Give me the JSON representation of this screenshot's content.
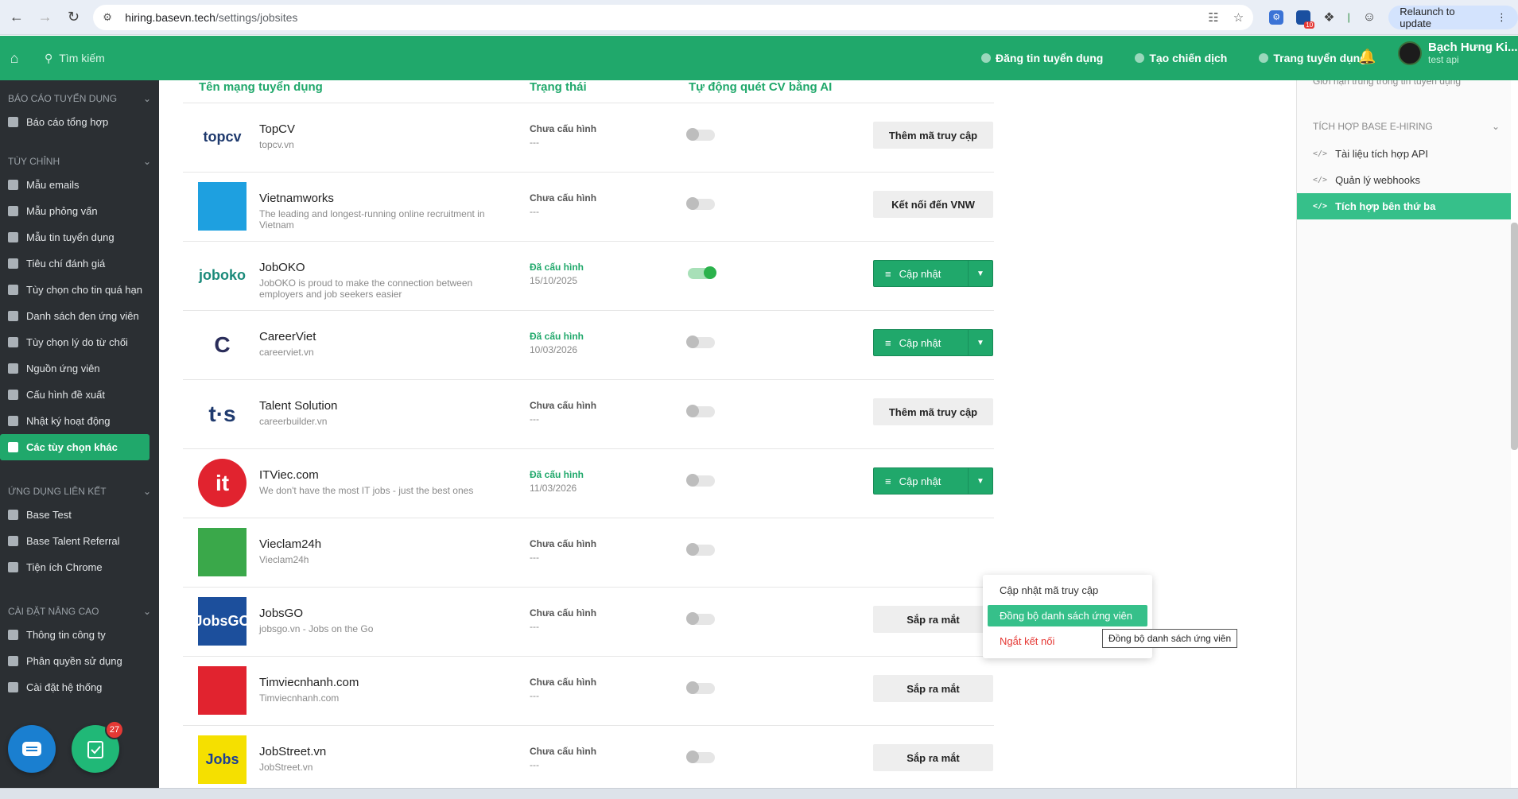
{
  "browser": {
    "url_host": "hiring.basevn.tech",
    "url_path": "/settings/jobsites",
    "relaunch_label": "Relaunch to update",
    "ext_badge": "10"
  },
  "header": {
    "search_placeholder": "Tìm kiếm",
    "actions": [
      "Đăng tin tuyển dụng",
      "Tạo chiến dịch",
      "Trang tuyển dụng"
    ],
    "user_name": "Bạch Hưng Ki...",
    "user_role": "test api"
  },
  "sidebar": {
    "sections": [
      {
        "title": "BÁO CÁO TUYỂN DỤNG",
        "items": [
          "Báo cáo tổng hợp"
        ]
      },
      {
        "title": "TÙY CHỈNH",
        "items": [
          "Mẫu emails",
          "Mẫu phỏng vấn",
          "Mẫu tin tuyển dụng",
          "Tiêu chí đánh giá",
          "Tùy chọn cho tin quá hạn",
          "Danh sách đen ứng viên",
          "Tùy chọn lý do từ chối",
          "Nguồn ứng viên",
          "Cấu hình đề xuất",
          "Nhật ký hoạt động",
          "Các tùy chọn khác"
        ]
      },
      {
        "title": "ỨNG DỤNG LIÊN KẾT",
        "items": [
          "Base Test",
          "Base Talent Referral",
          "Tiện ích Chrome"
        ]
      },
      {
        "title": "CÀI ĐẶT NÂNG CAO",
        "items": [
          "Thông tin công ty",
          "Phân quyền sử dụng",
          "Cài đặt hệ thống"
        ]
      }
    ],
    "active_item": "Các tùy chọn khác",
    "badge_count": "27"
  },
  "table": {
    "columns": [
      "Tên mạng tuyển dụng",
      "Trạng thái",
      "Tự động quét CV bằng AI"
    ],
    "rows": [
      {
        "name": "TopCV",
        "sub": "topcv.vn",
        "status": "Chưa cấu hình",
        "date": "---",
        "ai": false,
        "button": "Thêm mã truy cập",
        "btype": "grey",
        "logo_text": "topcv",
        "logo_color": "#1f3a6e"
      },
      {
        "name": "Vietnamworks",
        "sub": "The leading and longest-running online recruitment in Vietnam",
        "status": "Chưa cấu hình",
        "date": "---",
        "ai": false,
        "button": "Kết nối đến VNW",
        "btype": "grey",
        "logo_text": "",
        "logo_color": "#1ea0e0"
      },
      {
        "name": "JobOKO",
        "sub": "JobOKO is proud to make the connection between employers and job seekers easier",
        "status": "Đã cấu hình",
        "date": "15/10/2025",
        "ai": true,
        "button": "Cập nhật",
        "btype": "green",
        "logo_text": "joboko",
        "logo_color": "#1a8a7a"
      },
      {
        "name": "CareerViet",
        "sub": "careerviet.vn",
        "status": "Đã cấu hình",
        "date": "10/03/2026",
        "ai": false,
        "button": "Cập nhật",
        "btype": "green",
        "logo_text": "C",
        "logo_color": "#2a2d5a"
      },
      {
        "name": "Talent Solution",
        "sub": "careerbuilder.vn",
        "status": "Chưa cấu hình",
        "date": "---",
        "ai": false,
        "button": "Thêm mã truy cập",
        "btype": "grey",
        "logo_text": "t·s",
        "logo_color": "#1f3a6e"
      },
      {
        "name": "ITViec.com",
        "sub": "We don't have the most IT jobs - just the best ones",
        "status": "Đã cấu hình",
        "date": "11/03/2026",
        "ai": false,
        "button": "Cập nhật",
        "btype": "green",
        "logo_text": "it",
        "logo_color": "#e1232f"
      },
      {
        "name": "Vieclam24h",
        "sub": "Vieclam24h",
        "status": "Chưa cấu hình",
        "date": "---",
        "ai": false,
        "button": "",
        "btype": "none",
        "logo_text": "",
        "logo_color": "#3aa84a"
      },
      {
        "name": "JobsGO",
        "sub": "jobsgo.vn - Jobs on the Go",
        "status": "Chưa cấu hình",
        "date": "---",
        "ai": false,
        "button": "Sắp ra mắt",
        "btype": "grey",
        "logo_text": "JobsGO",
        "logo_color": "#1c4f9c"
      },
      {
        "name": "Timviecnhanh.com",
        "sub": "Timviecnhanh.com",
        "status": "Chưa cấu hình",
        "date": "---",
        "ai": false,
        "button": "Sắp ra mắt",
        "btype": "grey",
        "logo_text": "",
        "logo_color": "#e1232f"
      },
      {
        "name": "JobStreet.vn",
        "sub": "JobStreet.vn",
        "status": "Chưa cấu hình",
        "date": "---",
        "ai": false,
        "button": "Sắp ra mắt",
        "btype": "grey",
        "logo_text": "Jobs",
        "logo_color": "#f5e000"
      }
    ]
  },
  "dropdown": {
    "items": [
      "Cập nhật mã truy cập",
      "Đồng bộ danh sách ứng viên",
      "Ngắt kết nối"
    ],
    "highlighted": 1,
    "tooltip": "Đồng bộ danh sách ứng viên"
  },
  "right_panel": {
    "cut_item": "Giới hạn trùng trong tin tuyển dụng",
    "section_title": "TÍCH HỢP BASE E-HIRING",
    "items": [
      "Tài liệu tích hợp API",
      "Quản lý webhooks",
      "Tích hợp bên thứ ba"
    ],
    "active_item": "Tích hợp bên thứ ba"
  }
}
